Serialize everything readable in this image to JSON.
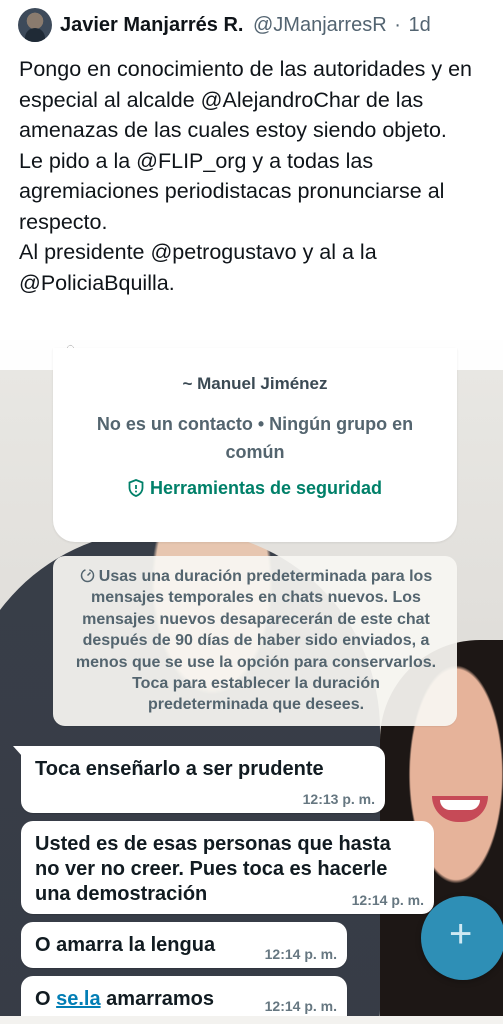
{
  "tweet": {
    "author_name": "Javier Manjarrés R.",
    "handle": "@JManjarresR",
    "separator": "·",
    "time": "1d",
    "body": "Pongo en conocimiento de las autoridades y en especial al alcalde @AlejandroChar de las amenazas de las cuales estoy siendo objeto.\nLe pido a la @FLIP_org y a todas las agremiaciones periodistacas pronunciarse al respecto.\nAl presidente @petrogustavo y al a la @PoliciaBquilla."
  },
  "chat": {
    "contact_name": "~ Manuel Jiménez",
    "contact_meta": "No es un contacto • Ningún grupo en común",
    "security_tools": "Herramientas de seguridad",
    "system_message": "Usas una duración predeterminada para los mensajes temporales en chats nuevos. Los mensajes nuevos desaparecerán de este chat después de 90 días de haber sido enviados, a menos que se use la opción para conservarlos. Toca para establecer la duración predeterminada que desees.",
    "messages": [
      {
        "text": "Toca enseñarlo a ser prudente",
        "time": "12:13 p. m."
      },
      {
        "text": "Usted es de esas personas que hasta\nno ver no creer. Pues toca es hacerle\nuna demostración",
        "time": "12:14 p. m."
      },
      {
        "text": "O amarra la lengua",
        "time": "12:14 p. m."
      },
      {
        "text_prefix": "O ",
        "text_link": "se.la",
        "text_suffix": " amarramos",
        "time": "12:14 p. m."
      }
    ],
    "fab_symbol": "+"
  },
  "icons": {
    "avatar": "avatar",
    "shield": "shield-icon",
    "timer": "timer-icon",
    "fab": "plus-icon"
  },
  "colors": {
    "accent_green": "#008069",
    "link_blue": "#027eb5",
    "fab_blue": "#2e8fb6"
  }
}
